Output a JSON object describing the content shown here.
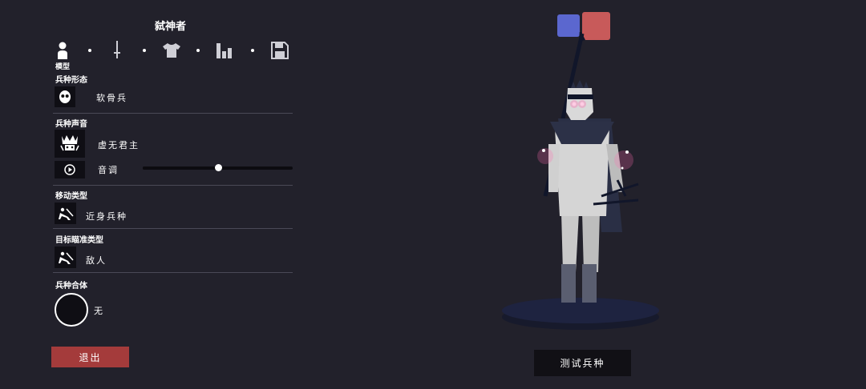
{
  "editor": {
    "title": "弑神者",
    "tabs": [
      {
        "icon": "model-icon"
      },
      {
        "icon": "sword-icon"
      },
      {
        "icon": "shirt-icon"
      },
      {
        "icon": "stats-icon"
      },
      {
        "icon": "save-icon"
      }
    ],
    "active_tab_label": "模型",
    "sections": {
      "form": {
        "label": "兵种形态",
        "value": "软骨兵",
        "icon": "skull-mask-icon"
      },
      "voice": {
        "label": "兵种声音",
        "value": "虚无君主",
        "icon": "crown-face-icon",
        "pitch_label": "音调",
        "pitch_level": 0.5,
        "play_icon": "play-icon"
      },
      "movement": {
        "label": "移动类型",
        "value": "近身兵种",
        "icon": "melee-unit-icon"
      },
      "targeting": {
        "label": "目标瞄准类型",
        "value": "敌人",
        "icon": "enemy-target-icon"
      },
      "merge": {
        "label": "兵种合体",
        "value": "无"
      }
    },
    "exit_label": "退出"
  },
  "preview": {
    "team_colors": [
      "#5b67cf",
      "#c85a5a"
    ],
    "test_button_label": "测试兵种"
  }
}
